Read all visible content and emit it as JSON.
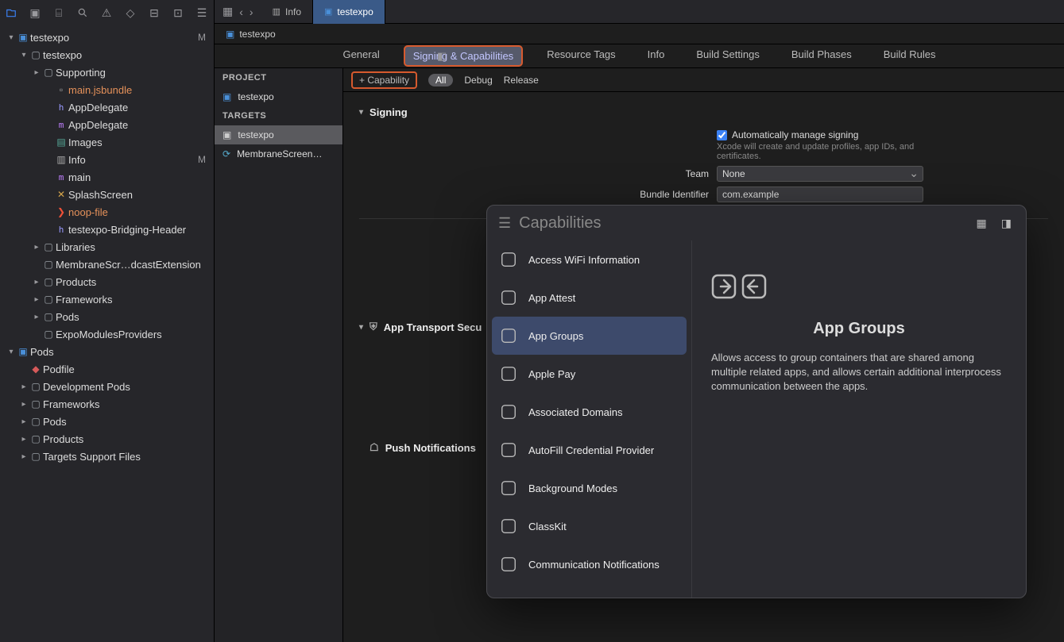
{
  "project_root": "testexpo",
  "sidebar": {
    "items": [
      {
        "indent": 0,
        "disclosure": "▾",
        "icon": "proj-blue",
        "label": "testexpo",
        "badge": "M"
      },
      {
        "indent": 1,
        "disclosure": "▾",
        "icon": "folder",
        "label": "testexpo"
      },
      {
        "indent": 2,
        "disclosure": "▸",
        "icon": "folder",
        "label": "Supporting"
      },
      {
        "indent": 3,
        "disclosure": "",
        "icon": "file",
        "label": "main.jsbundle",
        "orange": true
      },
      {
        "indent": 3,
        "disclosure": "",
        "icon": "h",
        "label": "AppDelegate"
      },
      {
        "indent": 3,
        "disclosure": "",
        "icon": "m",
        "label": "AppDelegate"
      },
      {
        "indent": 3,
        "disclosure": "",
        "icon": "images",
        "label": "Images"
      },
      {
        "indent": 3,
        "disclosure": "",
        "icon": "plist",
        "label": "Info",
        "badge": "M"
      },
      {
        "indent": 3,
        "disclosure": "",
        "icon": "m",
        "label": "main"
      },
      {
        "indent": 3,
        "disclosure": "",
        "icon": "splash",
        "label": "SplashScreen"
      },
      {
        "indent": 3,
        "disclosure": "",
        "icon": "swift",
        "label": "noop-file",
        "orange": true
      },
      {
        "indent": 3,
        "disclosure": "",
        "icon": "h",
        "label": "testexpo-Bridging-Header"
      },
      {
        "indent": 2,
        "disclosure": "▸",
        "icon": "folder",
        "label": "Libraries"
      },
      {
        "indent": 2,
        "disclosure": "",
        "icon": "folder",
        "label": "MembraneScr…dcastExtension"
      },
      {
        "indent": 2,
        "disclosure": "▸",
        "icon": "folder",
        "label": "Products"
      },
      {
        "indent": 2,
        "disclosure": "▸",
        "icon": "folder",
        "label": "Frameworks"
      },
      {
        "indent": 2,
        "disclosure": "▸",
        "icon": "folder",
        "label": "Pods"
      },
      {
        "indent": 2,
        "disclosure": "",
        "icon": "folder",
        "label": "ExpoModulesProviders"
      },
      {
        "indent": 0,
        "disclosure": "▾",
        "icon": "proj-blue",
        "label": "Pods"
      },
      {
        "indent": 1,
        "disclosure": "",
        "icon": "gem",
        "label": "Podfile"
      },
      {
        "indent": 1,
        "disclosure": "▸",
        "icon": "folder",
        "label": "Development Pods"
      },
      {
        "indent": 1,
        "disclosure": "▸",
        "icon": "folder",
        "label": "Frameworks"
      },
      {
        "indent": 1,
        "disclosure": "▸",
        "icon": "folder",
        "label": "Pods"
      },
      {
        "indent": 1,
        "disclosure": "▸",
        "icon": "folder",
        "label": "Products"
      },
      {
        "indent": 1,
        "disclosure": "▸",
        "icon": "folder",
        "label": "Targets Support Files"
      }
    ]
  },
  "tabs": [
    {
      "label": "Info",
      "icon": "plist",
      "active": false
    },
    {
      "label": "testexpo",
      "icon": "proj-blue",
      "active": true
    }
  ],
  "breadcrumb": {
    "icon": "proj-blue",
    "label": "testexpo"
  },
  "editor_tabs": [
    "General",
    "Signing & Capabilities",
    "Resource Tags",
    "Info",
    "Build Settings",
    "Build Phases",
    "Build Rules"
  ],
  "editor_tab_active": "Signing & Capabilities",
  "project_header": "PROJECT",
  "targets_header": "TARGETS",
  "project_name": "testexpo",
  "targets": [
    {
      "label": "testexpo",
      "icon": "app",
      "selected": true
    },
    {
      "label": "MembraneScreen…",
      "icon": "ext",
      "selected": false
    }
  ],
  "capability_btn": "+ Capability",
  "filter_tabs": [
    "All",
    "Debug",
    "Release"
  ],
  "filter_active": "All",
  "signing": {
    "header": "Signing",
    "auto_label": "Automatically manage signing",
    "auto_hint": "Xcode will create and update profiles, app IDs, and certificates.",
    "team_label": "Team",
    "team_value": "None",
    "bundle_label": "Bundle Identifier",
    "bundle_value": "com.example"
  },
  "ats_header": "App Transport Secu",
  "push_header": "Push Notifications",
  "popover": {
    "title": "Capabilities",
    "items": [
      "Access WiFi Information",
      "App Attest",
      "App Groups",
      "Apple Pay",
      "Associated Domains",
      "AutoFill Credential Provider",
      "Background Modes",
      "ClassKit",
      "Communication Notifications"
    ],
    "selected": "App Groups",
    "detail_title": "App Groups",
    "detail_body": "Allows access to group containers that are shared among multiple related apps, and allows certain additional interprocess communication between the apps."
  }
}
